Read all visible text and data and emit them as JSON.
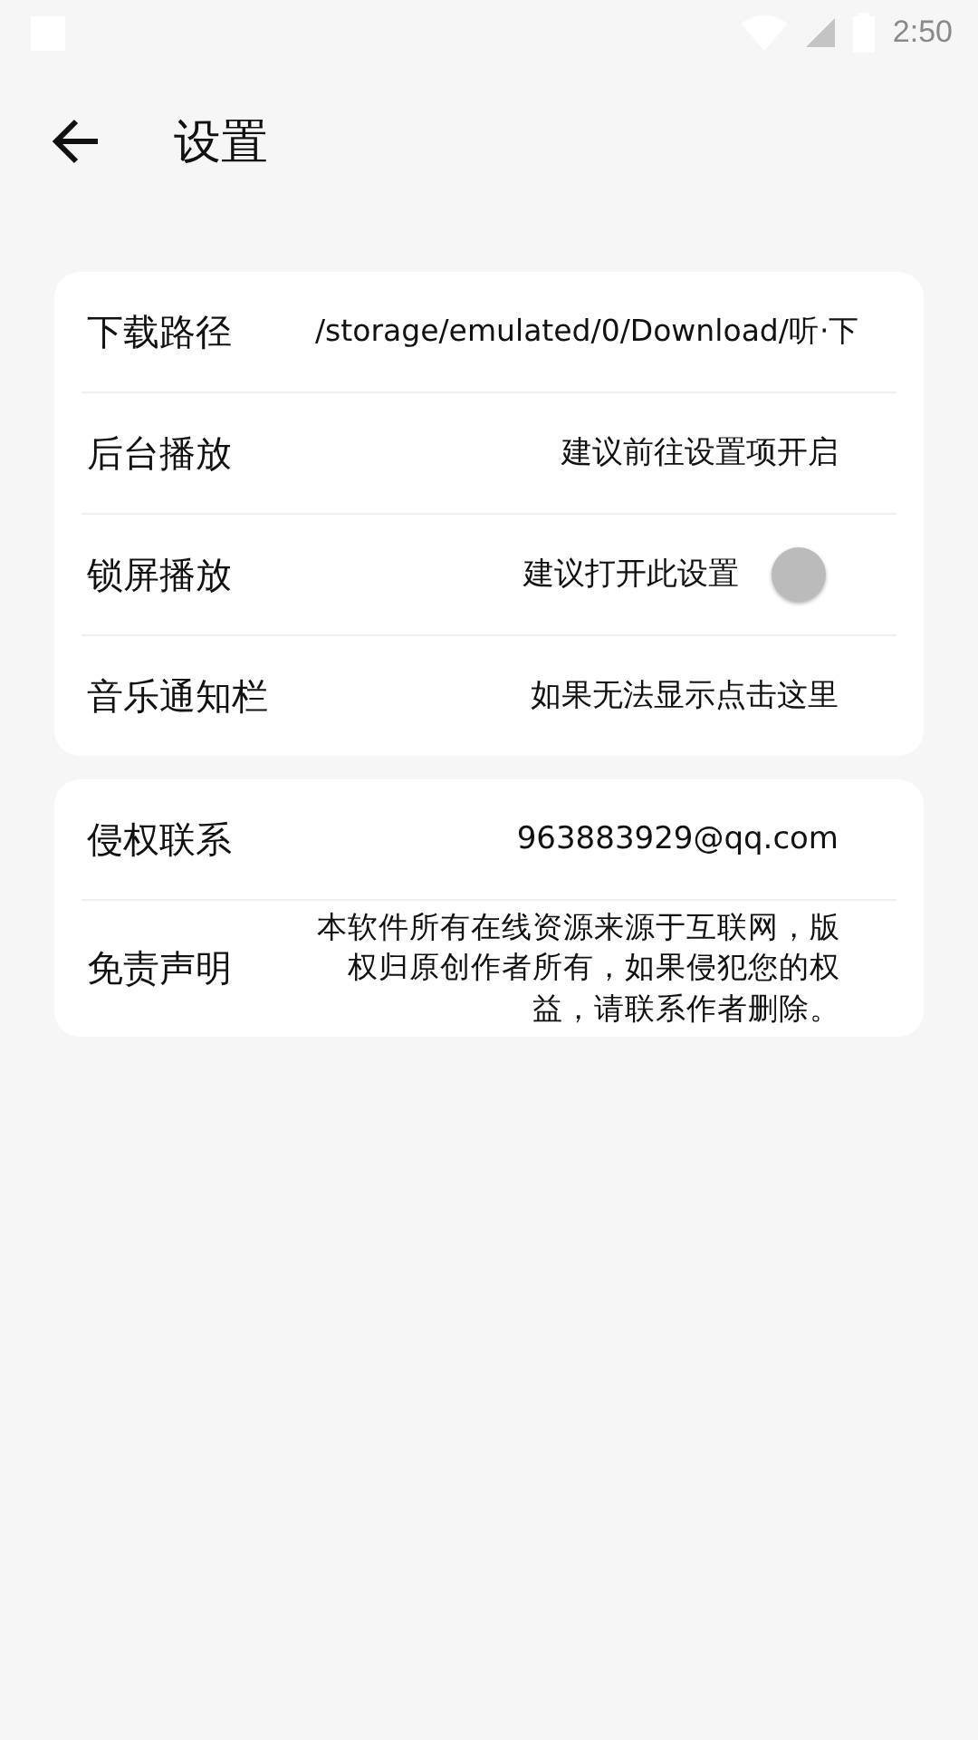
{
  "status_bar": {
    "time": "2:50"
  },
  "header": {
    "title": "设置"
  },
  "groups": [
    {
      "rows": [
        {
          "kind": "text",
          "label": "下载路径",
          "value": "/storage/emulated/0/Download/听·下"
        },
        {
          "kind": "text",
          "label": "后台播放",
          "value": "建议前往设置项开启"
        },
        {
          "kind": "switch",
          "label": "锁屏播放",
          "value": "建议打开此设置",
          "on": false
        },
        {
          "kind": "text",
          "label": "音乐通知栏",
          "value": "如果无法显示点击这里"
        }
      ]
    },
    {
      "rows": [
        {
          "kind": "text",
          "label": "侵权联系",
          "value": "963883929@qq.com"
        },
        {
          "kind": "text",
          "label": "免责声明",
          "value": "本软件所有在线资源来源于互联网，版权归原创作者所有，如果侵犯您的权益，请联系作者删除。"
        }
      ]
    }
  ]
}
